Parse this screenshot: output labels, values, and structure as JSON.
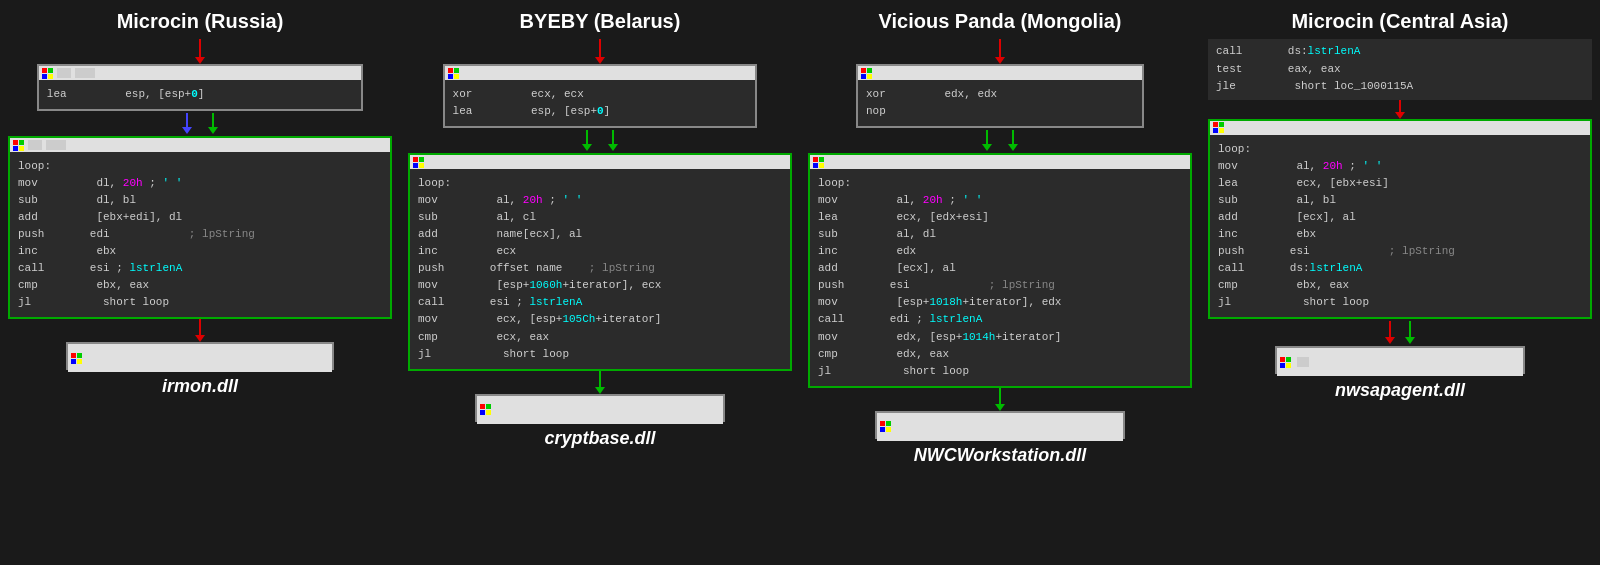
{
  "columns": [
    {
      "id": "col1",
      "title": "Microcin (Russia)",
      "dll": "irmon.dll",
      "top_code": {
        "lines": [
          {
            "mnemonic": "lea",
            "operands": "esp, [esp+0]"
          }
        ]
      },
      "main_code": {
        "lines": [
          {
            "label": "loop:",
            "mnemonic": "",
            "operands": "",
            "comment": ""
          },
          {
            "label": "",
            "mnemonic": "mov",
            "operands": "dl, 20h ;",
            "comment": "' '"
          },
          {
            "label": "",
            "mnemonic": "sub",
            "operands": "dl, bl",
            "comment": ""
          },
          {
            "label": "",
            "mnemonic": "add",
            "operands": "[ebx+edi], dl",
            "comment": ""
          },
          {
            "label": "",
            "mnemonic": "push",
            "operands": "edi",
            "comment": "; lpString"
          },
          {
            "label": "",
            "mnemonic": "inc",
            "operands": "ebx",
            "comment": ""
          },
          {
            "label": "",
            "mnemonic": "call",
            "operands": "esi ; lstrlenA",
            "comment": ""
          },
          {
            "label": "",
            "mnemonic": "cmp",
            "operands": "ebx, eax",
            "comment": ""
          },
          {
            "label": "",
            "mnemonic": "jl",
            "operands": "short loop",
            "comment": ""
          }
        ]
      }
    },
    {
      "id": "col2",
      "title": "BYEBY (Belarus)",
      "dll": "cryptbase.dll",
      "top_code": {
        "lines": [
          {
            "mnemonic": "xor",
            "operands": "ecx, ecx"
          },
          {
            "mnemonic": "lea",
            "operands": "esp, [esp+0]"
          }
        ]
      },
      "main_code": {
        "lines": [
          {
            "label": "loop:",
            "mnemonic": "",
            "operands": "",
            "comment": ""
          },
          {
            "label": "",
            "mnemonic": "mov",
            "operands": "al, 20h ;",
            "comment": "' '"
          },
          {
            "label": "",
            "mnemonic": "sub",
            "operands": "al, cl",
            "comment": ""
          },
          {
            "label": "",
            "mnemonic": "add",
            "operands": "name[ecx], al",
            "comment": ""
          },
          {
            "label": "",
            "mnemonic": "inc",
            "operands": "ecx",
            "comment": ""
          },
          {
            "label": "",
            "mnemonic": "push",
            "operands": "offset name",
            "comment": "; lpString"
          },
          {
            "label": "",
            "mnemonic": "mov",
            "operands": "[esp+1060h+iterator], ecx",
            "comment": ""
          },
          {
            "label": "",
            "mnemonic": "call",
            "operands": "esi ; lstrlenA",
            "comment": ""
          },
          {
            "label": "",
            "mnemonic": "mov",
            "operands": "ecx, [esp+105Ch+iterator]",
            "comment": ""
          },
          {
            "label": "",
            "mnemonic": "cmp",
            "operands": "ecx, eax",
            "comment": ""
          },
          {
            "label": "",
            "mnemonic": "jl",
            "operands": "short loop",
            "comment": ""
          }
        ]
      }
    },
    {
      "id": "col3",
      "title": "Vicious Panda (Mongolia)",
      "dll": "NWCWorkstation.dll",
      "top_code": {
        "lines": [
          {
            "mnemonic": "xor",
            "operands": "edx, edx"
          },
          {
            "mnemonic": "nop",
            "operands": ""
          }
        ]
      },
      "main_code": {
        "lines": [
          {
            "label": "loop:",
            "mnemonic": "",
            "operands": "",
            "comment": ""
          },
          {
            "label": "",
            "mnemonic": "mov",
            "operands": "al, 20h ;",
            "comment": "' '"
          },
          {
            "label": "",
            "mnemonic": "lea",
            "operands": "ecx, [edx+esi]",
            "comment": ""
          },
          {
            "label": "",
            "mnemonic": "sub",
            "operands": "al, dl",
            "comment": ""
          },
          {
            "label": "",
            "mnemonic": "inc",
            "operands": "edx",
            "comment": ""
          },
          {
            "label": "",
            "mnemonic": "add",
            "operands": "[ecx], al",
            "comment": ""
          },
          {
            "label": "",
            "mnemonic": "push",
            "operands": "esi",
            "comment": "; lpString"
          },
          {
            "label": "",
            "mnemonic": "mov",
            "operands": "[esp+1018h+iterator], edx",
            "comment": ""
          },
          {
            "label": "",
            "mnemonic": "call",
            "operands": "edi ; lstrlenA",
            "comment": ""
          },
          {
            "label": "",
            "mnemonic": "mov",
            "operands": "edx, [esp+1014h+iterator]",
            "comment": ""
          },
          {
            "label": "",
            "mnemonic": "cmp",
            "operands": "edx, eax",
            "comment": ""
          },
          {
            "label": "",
            "mnemonic": "jl",
            "operands": "short loop",
            "comment": ""
          }
        ]
      }
    },
    {
      "id": "col4",
      "title": "Microcin (Central Asia)",
      "dll": "nwsapagent.dll",
      "preamble": {
        "lines": [
          {
            "mnemonic": "call",
            "operands": "ds:lstrlenA"
          },
          {
            "mnemonic": "test",
            "operands": "eax, eax"
          },
          {
            "mnemonic": "jle",
            "operands": "short loc_1000115A"
          }
        ]
      },
      "main_code": {
        "lines": [
          {
            "label": "loop:",
            "mnemonic": "",
            "operands": "",
            "comment": ""
          },
          {
            "label": "",
            "mnemonic": "mov",
            "operands": "al, 20h ;",
            "comment": "' '"
          },
          {
            "label": "",
            "mnemonic": "lea",
            "operands": "ecx, [ebx+esi]",
            "comment": ""
          },
          {
            "label": "",
            "mnemonic": "sub",
            "operands": "al, bl",
            "comment": ""
          },
          {
            "label": "",
            "mnemonic": "add",
            "operands": "[ecx], al",
            "comment": ""
          },
          {
            "label": "",
            "mnemonic": "inc",
            "operands": "ebx",
            "comment": ""
          },
          {
            "label": "",
            "mnemonic": "push",
            "operands": "esi",
            "comment": "; lpString"
          },
          {
            "label": "",
            "mnemonic": "call",
            "operands": "ds:lstrlenA",
            "comment": ""
          },
          {
            "label": "",
            "mnemonic": "cmp",
            "operands": "ebx, eax",
            "comment": ""
          },
          {
            "label": "",
            "mnemonic": "jl",
            "operands": "short loop",
            "comment": ""
          }
        ]
      }
    }
  ]
}
